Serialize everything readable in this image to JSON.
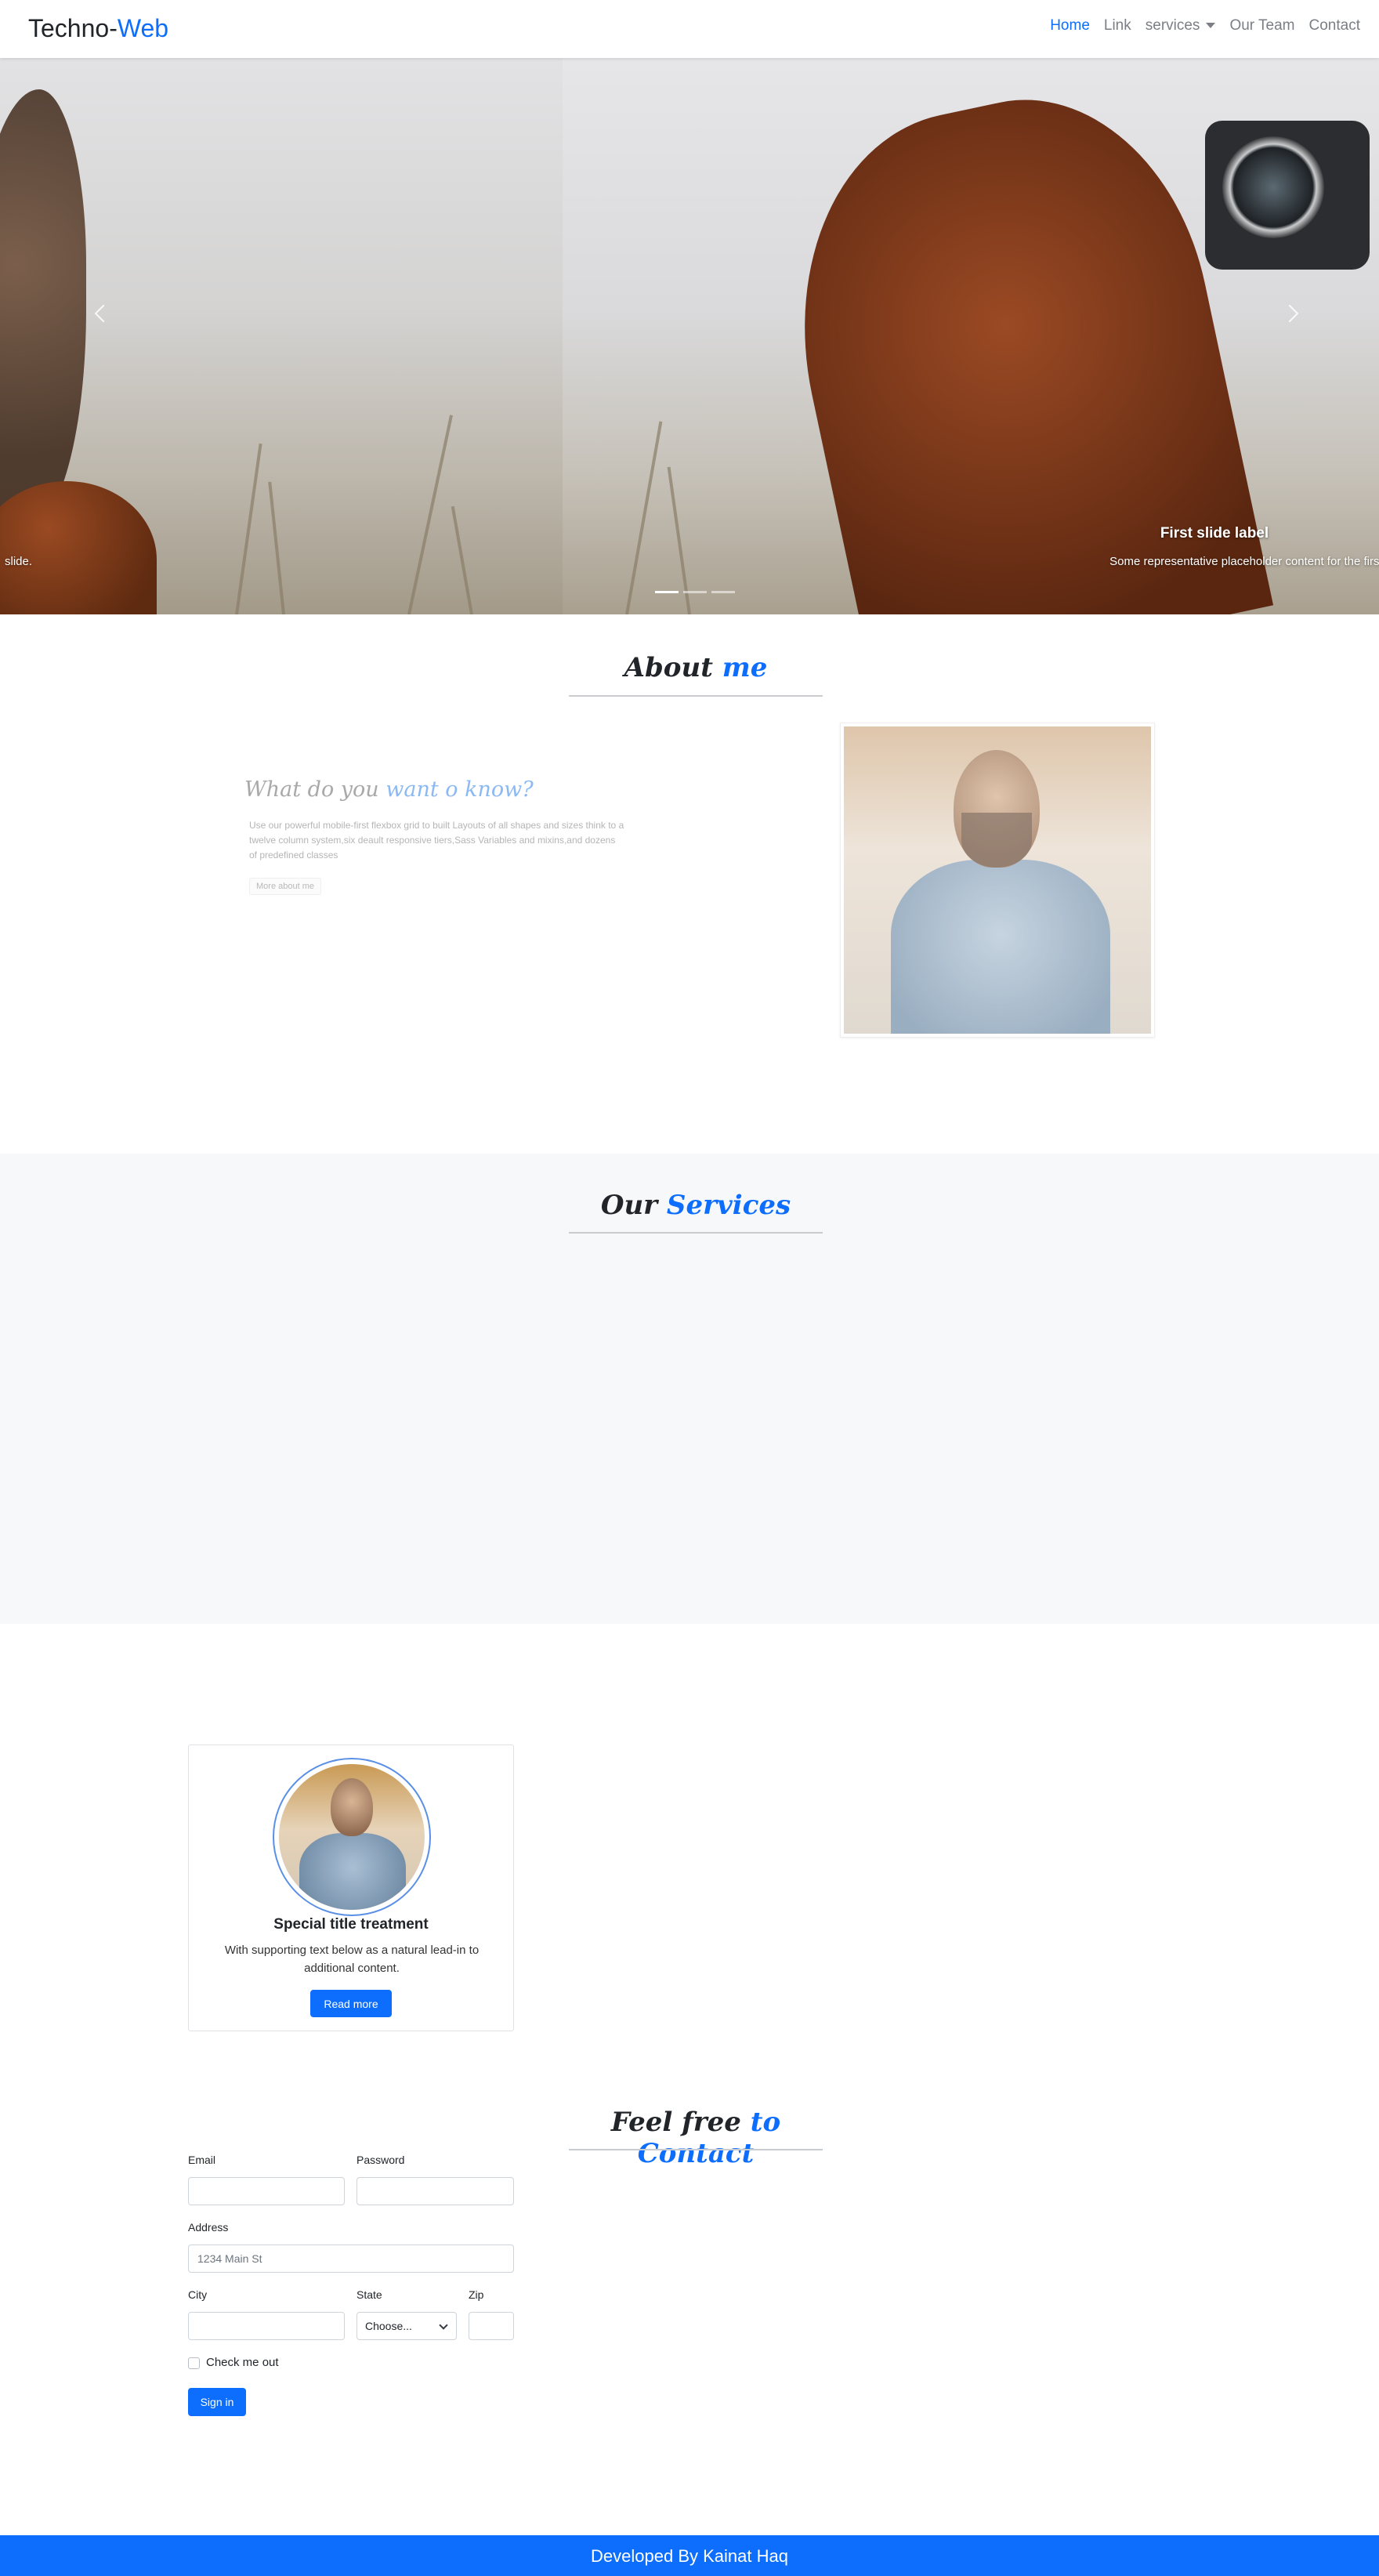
{
  "navbar": {
    "brand_main": "Techno-",
    "brand_accent": "Web",
    "links": [
      "Home",
      "Link",
      "services",
      "Our Team",
      "Contact"
    ],
    "active": "Home"
  },
  "carousel": {
    "caption_title": "First slide label",
    "caption_text": "Some representative placeholder content for the first slide.",
    "caption_left_fragment": "slide.",
    "indicator_count": 3,
    "active_indicator": 1,
    "prev_icon": "chevron-left-icon",
    "next_icon": "chevron-right-icon"
  },
  "about": {
    "title_main": "About ",
    "title_accent": "me",
    "subtitle_main": "What do you ",
    "subtitle_accent": "want o know?",
    "text": "Use our powerful mobile-first flexbox grid to built Layouts of all shapes and sizes think to a twelve column system,six deault responsive tiers,Sass Variables and mixins,and dozens of predefined classes",
    "button": "More about me"
  },
  "services": {
    "title_main": "Our ",
    "title_accent": "Services"
  },
  "card": {
    "title": "Special title treatment",
    "text": "With supporting text below as a natural lead-in to additional content.",
    "button": "Read more"
  },
  "contact": {
    "title_main": "Feel free ",
    "title_accent": "to Contact",
    "email_label": "Email",
    "email_value": "",
    "password_label": "Password",
    "password_value": "",
    "address_label": "Address",
    "address_placeholder": "1234 Main St",
    "city_label": "City",
    "city_value": "",
    "state_label": "State",
    "state_selected": "Choose...",
    "zip_label": "Zip",
    "zip_value": "",
    "check_label": "Check me out",
    "submit": "Sign in"
  },
  "footer": {
    "text": "Developed By Kainat Haq"
  },
  "colors": {
    "accent": "#0d6efd",
    "services_bg": "#f7f8fa"
  }
}
